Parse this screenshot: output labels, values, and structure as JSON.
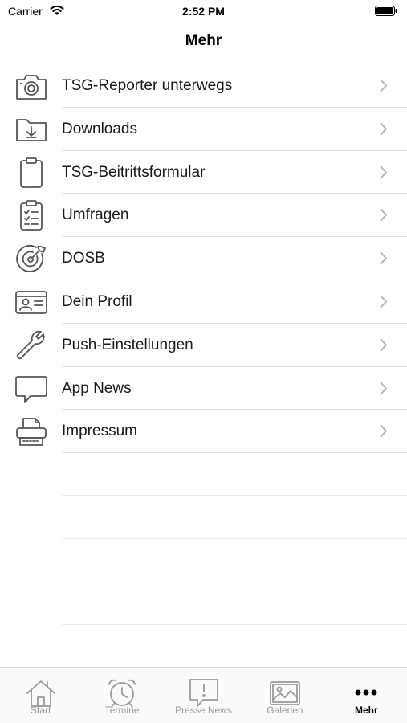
{
  "status_bar": {
    "carrier": "Carrier",
    "time": "2:52 PM"
  },
  "nav": {
    "title": "Mehr"
  },
  "menu": {
    "items": [
      {
        "label": "TSG-Reporter unterwegs",
        "icon": "camera-icon"
      },
      {
        "label": "Downloads",
        "icon": "folder-download-icon"
      },
      {
        "label": "TSG-Beitrittsformular",
        "icon": "clipboard-icon"
      },
      {
        "label": "Umfragen",
        "icon": "checklist-icon"
      },
      {
        "label": "DOSB",
        "icon": "target-icon"
      },
      {
        "label": "Dein Profil",
        "icon": "id-card-icon"
      },
      {
        "label": "Push-Einstellungen",
        "icon": "wrench-icon"
      },
      {
        "label": "App News",
        "icon": "speech-bubble-icon"
      },
      {
        "label": "Impressum",
        "icon": "printer-icon"
      }
    ]
  },
  "tabs": [
    {
      "label": "Start",
      "icon": "house-icon",
      "active": false
    },
    {
      "label": "Termine",
      "icon": "alarm-clock-icon",
      "active": false
    },
    {
      "label": "Presse News",
      "icon": "alert-bubble-icon",
      "active": false
    },
    {
      "label": "Galerien",
      "icon": "image-icon",
      "active": false
    },
    {
      "label": "Mehr",
      "icon": "more-dots-icon",
      "active": true
    }
  ],
  "colors": {
    "icon_gray": "#555555",
    "tab_inactive": "#9a9a9a",
    "separator": "#e3e3e6"
  }
}
